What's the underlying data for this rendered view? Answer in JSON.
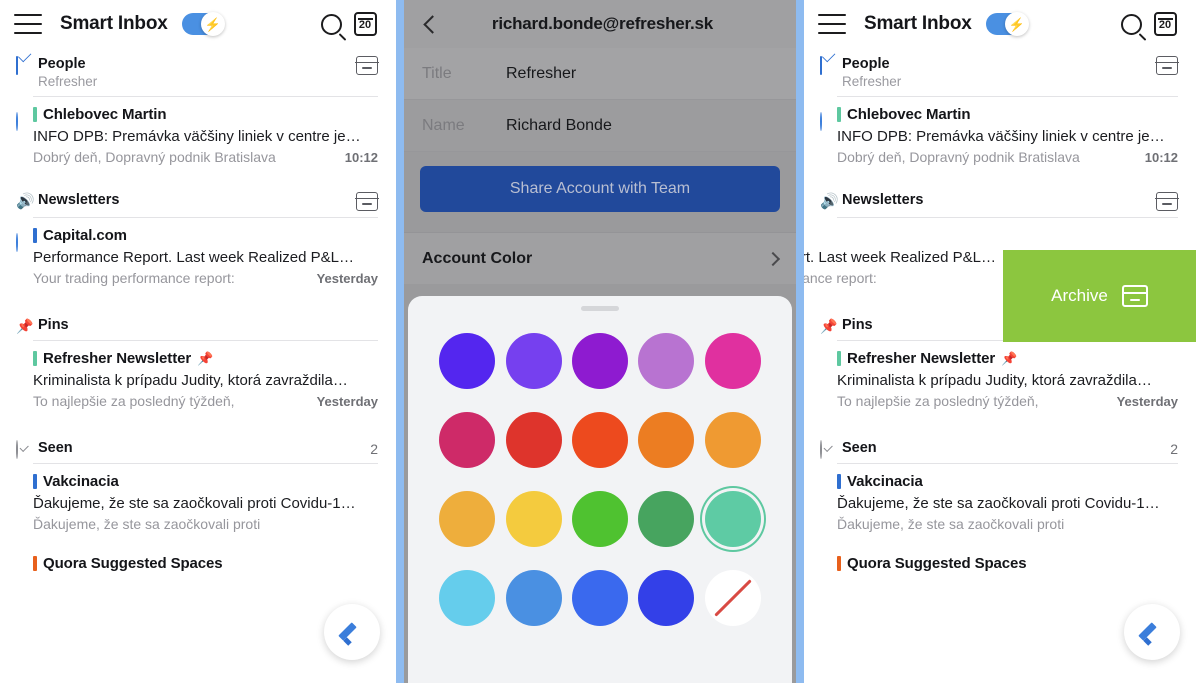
{
  "panels": {
    "left": {
      "topbar": {
        "title": "Smart Inbox",
        "menu_icon": "hamburger-icon",
        "toggle_icon": "bolt-icon",
        "search_icon": "search-icon",
        "calendar_icon": "calendar-icon",
        "calendar_day": "20"
      },
      "sections": [
        {
          "id": "people",
          "icon": "envelope-icon",
          "title": "People",
          "subtitle": "Refresher",
          "right": "",
          "archive_icon": "archive-icon"
        },
        {
          "id": "newsletters",
          "icon": "rss-icon",
          "title": "Newsletters",
          "subtitle": "",
          "right": "",
          "archive_icon": "archive-icon"
        },
        {
          "id": "pins",
          "icon": "pin-icon",
          "title": "Pins",
          "subtitle": "",
          "right": "",
          "archive_icon": ""
        },
        {
          "id": "seen",
          "icon": "seen-icon",
          "title": "Seen",
          "subtitle": "",
          "right": "2",
          "archive_icon": ""
        }
      ],
      "messages": [
        {
          "id": "chlebovec",
          "unread": true,
          "tag_color": "#5ec8a0",
          "sender": "Chlebovec Martin",
          "pinned": false,
          "subject": "INFO DPB: Premávka väčšiny liniek v centre je…",
          "preview": "Dobrý deň, Dopravný podnik Bratislava",
          "time": "10:12"
        },
        {
          "id": "capital",
          "unread": true,
          "tag_color": "#2f6fd0",
          "sender": "Capital.com",
          "pinned": false,
          "subject": "Performance Report. Last week Realized P&L…",
          "preview": "Your trading performance report:",
          "time": "Yesterday"
        },
        {
          "id": "refresher-newsletter",
          "unread": false,
          "tag_color": "#5ec8a0",
          "sender": "Refresher Newsletter",
          "pinned": true,
          "subject": "Kriminalista k prípadu Judity, ktorá zavraždila…",
          "preview": "To najlepšie za posledný týždeň,",
          "time": "Yesterday"
        },
        {
          "id": "vakcinacia",
          "unread": false,
          "tag_color": "#2f6fd0",
          "sender": "Vakcinacia",
          "pinned": false,
          "subject": "Ďakujeme, že ste sa zaočkovali proti Covidu-1…",
          "preview": "Ďakujeme, že ste sa zaočkovali proti",
          "time": ""
        },
        {
          "id": "quora",
          "unread": false,
          "tag_color": "#e8601c",
          "sender": "Quora Suggested Spaces",
          "pinned": false,
          "subject": "",
          "preview": "",
          "time": ""
        }
      ],
      "compose_icon": "pencil-icon"
    },
    "middle": {
      "topbar": {
        "back_icon": "back-chevron-icon",
        "title": "richard.bonde@refresher.sk"
      },
      "fields": [
        {
          "label": "Title",
          "value": "Refresher"
        },
        {
          "label": "Name",
          "value": "Richard Bonde"
        }
      ],
      "share_button": "Share Account with Team",
      "account_color_row": {
        "label": "Account Color",
        "chevron_icon": "chevron-right-icon"
      },
      "color_sheet": {
        "grabber": "sheet-grab-handle",
        "selected_index": 14,
        "swatches": [
          "#5426ef",
          "#7640ef",
          "#8e1bd0",
          "#b873d1",
          "#e0309f",
          "#ce2a68",
          "#de342c",
          "#ed4a1e",
          "#ec7d22",
          "#ef9a32",
          "#eeae3c",
          "#f4cb3e",
          "#4fc230",
          "#47a45f",
          "#5ecba4",
          "#65cdec",
          "#4a90e2",
          "#3a69ee",
          "#3340e8",
          "none"
        ]
      }
    },
    "right": {
      "topbar": {
        "title": "Smart Inbox",
        "calendar_day": "20"
      },
      "swipe_action": {
        "label": "Archive",
        "color": "#8cc63f",
        "icon": "archive-icon",
        "row_id": "capital"
      }
    }
  }
}
